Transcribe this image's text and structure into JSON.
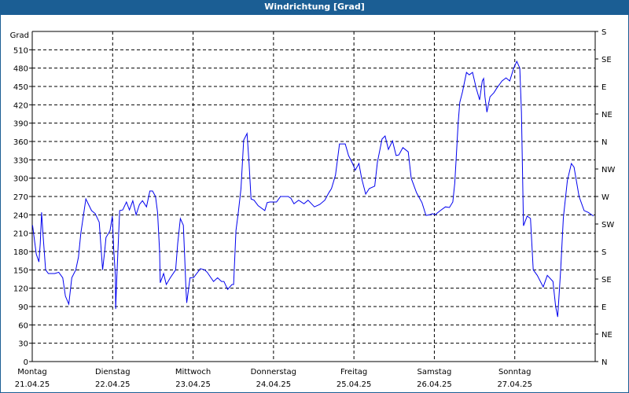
{
  "window": {
    "title": "Windrichtung [Grad]"
  },
  "colors": {
    "titlebar": "#1b5e94",
    "series": "#0000ee",
    "grid": "#000000"
  },
  "chart_data": {
    "type": "line",
    "title": "Windrichtung [Grad]",
    "ylabel": "Grad",
    "ylim": [
      0,
      540
    ],
    "yticks": [
      0,
      30,
      60,
      90,
      120,
      150,
      180,
      210,
      240,
      270,
      300,
      330,
      360,
      390,
      420,
      450,
      480,
      510
    ],
    "y2ticks": [
      {
        "value": 0,
        "label": "N"
      },
      {
        "value": 45,
        "label": "NE"
      },
      {
        "value": 90,
        "label": "E"
      },
      {
        "value": 135,
        "label": "SE"
      },
      {
        "value": 180,
        "label": "S"
      },
      {
        "value": 225,
        "label": "SW"
      },
      {
        "value": 270,
        "label": "W"
      },
      {
        "value": 315,
        "label": "NW"
      },
      {
        "value": 360,
        "label": "N"
      },
      {
        "value": 405,
        "label": "NE"
      },
      {
        "value": 450,
        "label": "E"
      },
      {
        "value": 495,
        "label": "SE"
      },
      {
        "value": 540,
        "label": "S"
      }
    ],
    "xlim_hours": [
      0,
      168
    ],
    "xticks": [
      {
        "hour": 0,
        "day": "Montag",
        "date": "21.04.25"
      },
      {
        "hour": 24,
        "day": "Dienstag",
        "date": "22.04.25"
      },
      {
        "hour": 48,
        "day": "Mittwoch",
        "date": "23.04.25"
      },
      {
        "hour": 72,
        "day": "Donnerstag",
        "date": "24.04.25"
      },
      {
        "hour": 96,
        "day": "Freitag",
        "date": "25.04.25"
      },
      {
        "hour": 120,
        "day": "Samstag",
        "date": "26.04.25"
      },
      {
        "hour": 144,
        "day": "Sonntag",
        "date": "27.04.25"
      }
    ],
    "grid": true,
    "series": [
      {
        "name": "Windrichtung",
        "points": [
          [
            0.1,
            223
          ],
          [
            0.5,
            206
          ],
          [
            1.2,
            176
          ],
          [
            2.0,
            163
          ],
          [
            2.4,
            193
          ],
          [
            2.8,
            244
          ],
          [
            3.2,
            210
          ],
          [
            3.6,
            180
          ],
          [
            4.0,
            150
          ],
          [
            4.8,
            144
          ],
          [
            6.7,
            144
          ],
          [
            7.9,
            146
          ],
          [
            9.1,
            137
          ],
          [
            9.9,
            107
          ],
          [
            10.9,
            94
          ],
          [
            11.8,
            137
          ],
          [
            13.0,
            150
          ],
          [
            13.8,
            171
          ],
          [
            14.5,
            210
          ],
          [
            16.0,
            266
          ],
          [
            17.7,
            247
          ],
          [
            18.8,
            242
          ],
          [
            20.0,
            228
          ],
          [
            21.0,
            150
          ],
          [
            21.6,
            180
          ],
          [
            22.0,
            203
          ],
          [
            23.2,
            214
          ],
          [
            23.9,
            238
          ],
          [
            24.3,
            184
          ],
          [
            24.8,
            141
          ],
          [
            24.9,
            86
          ],
          [
            25.3,
            145
          ],
          [
            26.1,
            247
          ],
          [
            27.0,
            248
          ],
          [
            28.1,
            261
          ],
          [
            29.0,
            248
          ],
          [
            30.0,
            263
          ],
          [
            31.0,
            240
          ],
          [
            32.0,
            257
          ],
          [
            32.9,
            263
          ],
          [
            34.1,
            253
          ],
          [
            35.1,
            279
          ],
          [
            35.9,
            279
          ],
          [
            36.8,
            270
          ],
          [
            37.4,
            244
          ],
          [
            38.0,
            180
          ],
          [
            38.2,
            129
          ],
          [
            39.2,
            144
          ],
          [
            40.0,
            126
          ],
          [
            41.2,
            137
          ],
          [
            42.8,
            150
          ],
          [
            43.4,
            193
          ],
          [
            44.2,
            234
          ],
          [
            45.1,
            223
          ],
          [
            45.5,
            171
          ],
          [
            45.9,
            116
          ],
          [
            46.1,
            96
          ],
          [
            47.1,
            137
          ],
          [
            48.1,
            137
          ],
          [
            50.2,
            152
          ],
          [
            51.4,
            150
          ],
          [
            52.2,
            146
          ],
          [
            54.1,
            131
          ],
          [
            55.3,
            137
          ],
          [
            56.5,
            131
          ],
          [
            57.2,
            131
          ],
          [
            58.3,
            118
          ],
          [
            59.6,
            126
          ],
          [
            60.1,
            126
          ],
          [
            60.8,
            214
          ],
          [
            61.5,
            244
          ],
          [
            62.3,
            283
          ],
          [
            63.1,
            362
          ],
          [
            64.1,
            373
          ],
          [
            64.7,
            326
          ],
          [
            65.3,
            266
          ],
          [
            66.2,
            264
          ],
          [
            67.4,
            255
          ],
          [
            69.4,
            247
          ],
          [
            70.1,
            260
          ],
          [
            70.9,
            261
          ],
          [
            72.9,
            261
          ],
          [
            74.1,
            270
          ],
          [
            76.4,
            270
          ],
          [
            77.2,
            267
          ],
          [
            78.1,
            258
          ],
          [
            79.5,
            264
          ],
          [
            81.1,
            258
          ],
          [
            82.3,
            264
          ],
          [
            84.2,
            253
          ],
          [
            85.8,
            257
          ],
          [
            87.3,
            264
          ],
          [
            88.5,
            276
          ],
          [
            89.3,
            283
          ],
          [
            90.5,
            305
          ],
          [
            91.7,
            356
          ],
          [
            93.4,
            356
          ],
          [
            94.4,
            337
          ],
          [
            95.6,
            324
          ],
          [
            96.4,
            313
          ],
          [
            97.5,
            324
          ],
          [
            98.3,
            300
          ],
          [
            99.5,
            274
          ],
          [
            100.6,
            283
          ],
          [
            102.2,
            287
          ],
          [
            103.0,
            326
          ],
          [
            104.4,
            364
          ],
          [
            105.3,
            369
          ],
          [
            106.3,
            347
          ],
          [
            107.5,
            361
          ],
          [
            108.6,
            337
          ],
          [
            109.4,
            338
          ],
          [
            110.6,
            350
          ],
          [
            112.2,
            343
          ],
          [
            113.1,
            300
          ],
          [
            114.7,
            276
          ],
          [
            116.3,
            260
          ],
          [
            117.5,
            239
          ],
          [
            118.6,
            240
          ],
          [
            119.4,
            242
          ],
          [
            120.2,
            240
          ],
          [
            121.8,
            247
          ],
          [
            123.3,
            253
          ],
          [
            124.5,
            252
          ],
          [
            125.5,
            261
          ],
          [
            126.1,
            292
          ],
          [
            126.5,
            330
          ],
          [
            127.1,
            390
          ],
          [
            127.6,
            424
          ],
          [
            128.4,
            441
          ],
          [
            129.6,
            473
          ],
          [
            130.4,
            469
          ],
          [
            131.4,
            473
          ],
          [
            132.5,
            447
          ],
          [
            133.5,
            428
          ],
          [
            134.3,
            459
          ],
          [
            134.7,
            463
          ],
          [
            135.1,
            433
          ],
          [
            135.7,
            408
          ],
          [
            136.6,
            433
          ],
          [
            137.8,
            440
          ],
          [
            138.6,
            447
          ],
          [
            140.2,
            459
          ],
          [
            141.4,
            464
          ],
          [
            142.5,
            459
          ],
          [
            143.7,
            480
          ],
          [
            144.6,
            491
          ],
          [
            145.5,
            480
          ],
          [
            146.0,
            408
          ],
          [
            146.6,
            222
          ],
          [
            147.7,
            238
          ],
          [
            148.7,
            234
          ],
          [
            149.5,
            150
          ],
          [
            150.7,
            141
          ],
          [
            152.5,
            122
          ],
          [
            153.7,
            141
          ],
          [
            155.4,
            131
          ],
          [
            156.2,
            90
          ],
          [
            156.8,
            73
          ],
          [
            157.7,
            150
          ],
          [
            158.5,
            235
          ],
          [
            159.7,
            296
          ],
          [
            160.9,
            324
          ],
          [
            161.7,
            318
          ],
          [
            163.2,
            270
          ],
          [
            164.7,
            247
          ],
          [
            165.9,
            244
          ],
          [
            167.5,
            238
          ]
        ]
      }
    ]
  }
}
